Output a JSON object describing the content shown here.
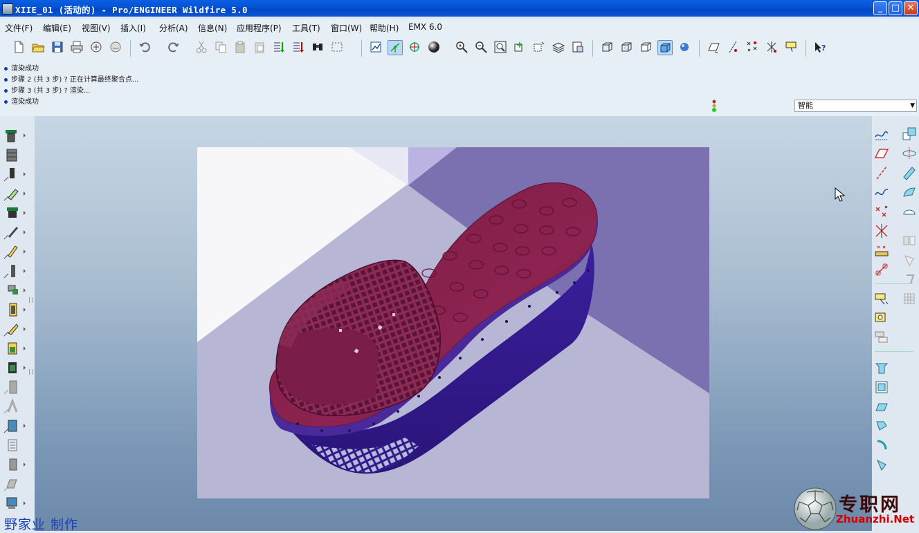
{
  "window": {
    "title": "XIIE_01 (活动的) - Pro/ENGINEER Wildfire 5.0",
    "controls": {
      "minimize": "_",
      "maximize": "□",
      "close": "✕"
    }
  },
  "menubar": {
    "items": [
      "文件(F)",
      "编辑(E)",
      "视图(V)",
      "插入(I)",
      "分析(A)",
      "信息(N)",
      "应用程序(P)",
      "工具(T)",
      "窗口(W)",
      "帮助(H)",
      "EMX 6.0"
    ]
  },
  "toolbar": {
    "icons": [
      "new-file-icon",
      "open-folder-icon",
      "save-icon",
      "print-icon",
      "send-mail-icon",
      "send-mail-alt-icon",
      "undo-icon",
      "redo-icon",
      "cut-icon",
      "copy-icon",
      "paste-icon",
      "paste-special-icon",
      "regenerate-icon",
      "regen-manager-icon",
      "find-icon",
      "select-box-icon",
      "repaint-icon",
      "spin-center-icon",
      "orient-mode-icon",
      "appearance-sphere-icon",
      "zoom-in-icon",
      "zoom-out-icon",
      "refit-icon",
      "reorient-icon",
      "saved-views-icon",
      "layers-icon",
      "view-manager-icon",
      "wireframe-icon",
      "hidden-line-icon",
      "no-hidden-icon",
      "shading-icon",
      "enhanced-realism-icon",
      "datum-planes-icon",
      "datum-axes-icon",
      "datum-points-icon",
      "coordinate-systems-icon",
      "annotations-icon",
      "context-help-icon"
    ]
  },
  "messages": [
    "渲染成功",
    "步骤 2 (共 3 步) ? 正在计算最终聚合点...",
    "步骤 3 (共 3 步) ? 渲染...",
    "渲染成功"
  ],
  "filter": {
    "value": "智能"
  },
  "caption": "野家业 制作",
  "watermark": {
    "cn": "专职网",
    "url": "Zhuanzhi.Net"
  }
}
